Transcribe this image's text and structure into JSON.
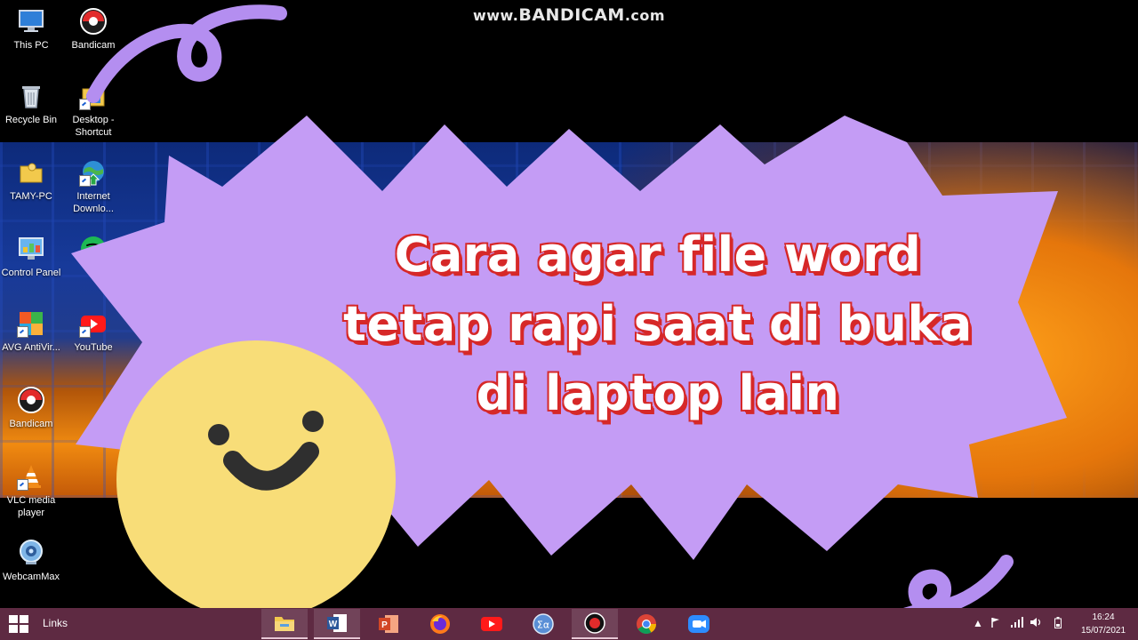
{
  "watermark": {
    "prefix": "www.",
    "brand": "BANDICAM",
    "suffix": ".com"
  },
  "desktop_icons": [
    {
      "label": "This PC"
    },
    {
      "label": "Bandicam"
    },
    {
      "label": "Recycle Bin"
    },
    {
      "label": "Desktop - Shortcut"
    },
    {
      "label": "TAMY-PC"
    },
    {
      "label": "Internet Downlo..."
    },
    {
      "label": "Control Panel"
    },
    {
      "label": ""
    },
    {
      "label": "AVG AntiVir..."
    },
    {
      "label": "YouTube"
    },
    {
      "label": "Bandicam"
    },
    {
      "label": "VLC media player"
    },
    {
      "label": "WebcamMax"
    }
  ],
  "overlay": {
    "title_lines": [
      "Cara agar file word",
      "tetap rapi saat di buka",
      "di laptop lain"
    ],
    "colors": {
      "sticker": "#c49cf5",
      "swirl": "#b48ef0",
      "smiley": "#f8dd78",
      "text_outline": "#d62828"
    }
  },
  "taskbar": {
    "links_label": "Links",
    "apps": [
      "file-explorer",
      "word",
      "powerpoint",
      "firefox",
      "youtube",
      "math-input",
      "bandicam-record",
      "chrome",
      "zoom"
    ],
    "clock": {
      "time": "16:24",
      "date": "15/07/2021"
    },
    "color": "#5e2a42"
  }
}
